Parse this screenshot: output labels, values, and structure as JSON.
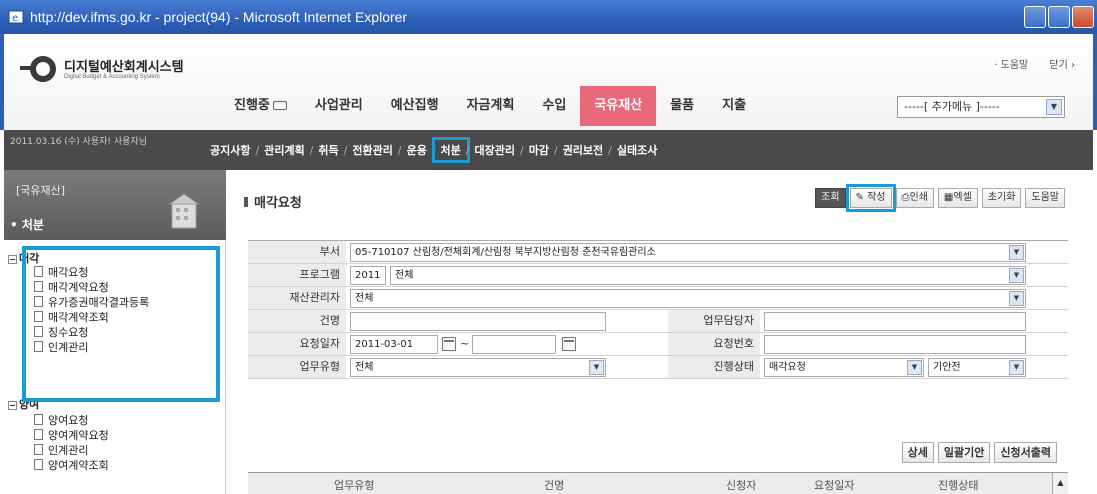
{
  "window": {
    "title": "http://dev.ifms.go.kr - project(94) - Microsoft Internet Explorer"
  },
  "header": {
    "logo_name": "디지털예산회계시스템",
    "logo_sub": "Digital Budget & Accounting System",
    "toplinks": [
      "· 도움말",
      "닫기 ›"
    ],
    "nav": [
      {
        "label": "진행중",
        "badge": true
      },
      {
        "label": "사업관리"
      },
      {
        "label": "예산집행"
      },
      {
        "label": "자금계획"
      },
      {
        "label": "수입"
      },
      {
        "label": "국유재산",
        "active": true
      },
      {
        "label": "물품"
      },
      {
        "label": "지출"
      }
    ],
    "extra_menu": "-----[ 추가메뉴 ]-----"
  },
  "subnav": {
    "userinfo": "2011.03.16 (수) 사용자! 사용자님",
    "items": [
      "공지사항",
      "관리계획",
      "취득",
      "전환관리",
      "운용",
      "처분",
      "대장관리",
      "마감",
      "권리보전",
      "실태조사"
    ],
    "highlighted": "처분"
  },
  "sidebar": {
    "category": "[국유재산]",
    "current": "• 처분",
    "tree": [
      {
        "label": "매각",
        "type": "folder"
      },
      {
        "label": "매각요청",
        "type": "doc"
      },
      {
        "label": "매각계약요청",
        "type": "doc"
      },
      {
        "label": "유가증권매각결과등록",
        "type": "doc"
      },
      {
        "label": "매각계약조회",
        "type": "doc"
      },
      {
        "label": "징수요청",
        "type": "doc"
      },
      {
        "label": "인계관리",
        "type": "doc"
      },
      {
        "label": "양여",
        "type": "folder"
      },
      {
        "label": "양여요청",
        "type": "doc"
      },
      {
        "label": "양여계약요청",
        "type": "doc"
      },
      {
        "label": "인계관리",
        "type": "doc"
      },
      {
        "label": "양여계약조회",
        "type": "doc"
      }
    ]
  },
  "page": {
    "title": "매각요청",
    "toolbar": [
      "조회",
      "작성",
      "인쇄",
      "엑셀",
      "초기화",
      "도움말"
    ],
    "form": {
      "dept_label": "부서",
      "dept_value": "05-710107 산림청/전체회계/산림청 북부지방산림청 춘천국유림관리소",
      "program_label": "프로그램",
      "program_year": "2011",
      "program_value": "전체",
      "manager_label": "재산관리자",
      "manager_value": "전체",
      "case_label": "건명",
      "case_value": "",
      "staff_label": "업무담당자",
      "staff_value": "",
      "reqdate_label": "요청일자",
      "reqdate_from": "2011-03-01",
      "reqdate_tilde": "~",
      "reqdate_to": "",
      "reqno_label": "요청번호",
      "reqno_value": "",
      "worktype_label": "업무유형",
      "worktype_value": "전체",
      "status_label": "진행상태",
      "status_value": "매각요청",
      "status_sub": "기안전"
    },
    "actions": [
      "상세",
      "일괄기안",
      "신청서출력"
    ],
    "columns": [
      "업무유형",
      "건명",
      "신청자",
      "요청일자",
      "진행상태"
    ]
  }
}
